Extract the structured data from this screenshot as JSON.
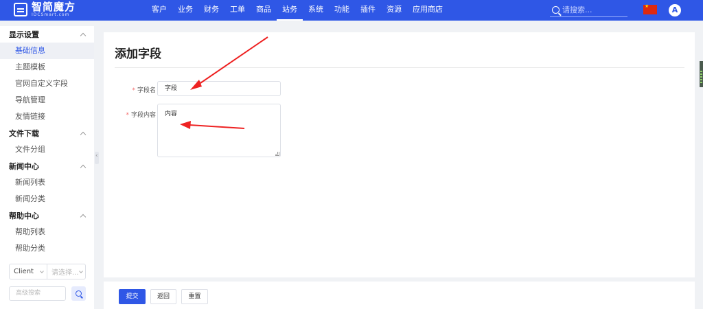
{
  "logo": {
    "name": "智简魔方",
    "sub": "IDCSmart.com"
  },
  "nav": [
    "客户",
    "业务",
    "财务",
    "工单",
    "商品",
    "站务",
    "系统",
    "功能",
    "插件",
    "资源",
    "应用商店"
  ],
  "nav_active": 5,
  "search": {
    "placeholder": "请搜索..."
  },
  "avatar_letter": "A",
  "sidebar": {
    "groups": [
      {
        "title": "显示设置",
        "expanded": true,
        "items": [
          "基础信息",
          "主题模板",
          "官网自定义字段",
          "导航管理",
          "友情链接"
        ]
      },
      {
        "title": "文件下载",
        "expanded": true,
        "items": [
          "文件分组"
        ]
      },
      {
        "title": "新闻中心",
        "expanded": true,
        "items": [
          "新闻列表",
          "新闻分类"
        ]
      },
      {
        "title": "帮助中心",
        "expanded": true,
        "items": [
          "帮助列表",
          "帮助分类"
        ]
      }
    ],
    "active_item": "基础信息",
    "client_select": "Client",
    "second_select_placeholder": "请选择...",
    "advanced_search_placeholder": "高级搜索"
  },
  "page": {
    "title": "添加字段",
    "fields": [
      {
        "label": "字段名",
        "required": true,
        "value": "字段"
      },
      {
        "label": "字段内容",
        "required": true,
        "value": "内容"
      }
    ]
  },
  "buttons": {
    "submit": "提交",
    "back": "返回",
    "reset": "重置"
  },
  "colors": {
    "brand": "#2f57e6",
    "required": "#f56c6c",
    "annotation_arrow": "#ee2222"
  }
}
